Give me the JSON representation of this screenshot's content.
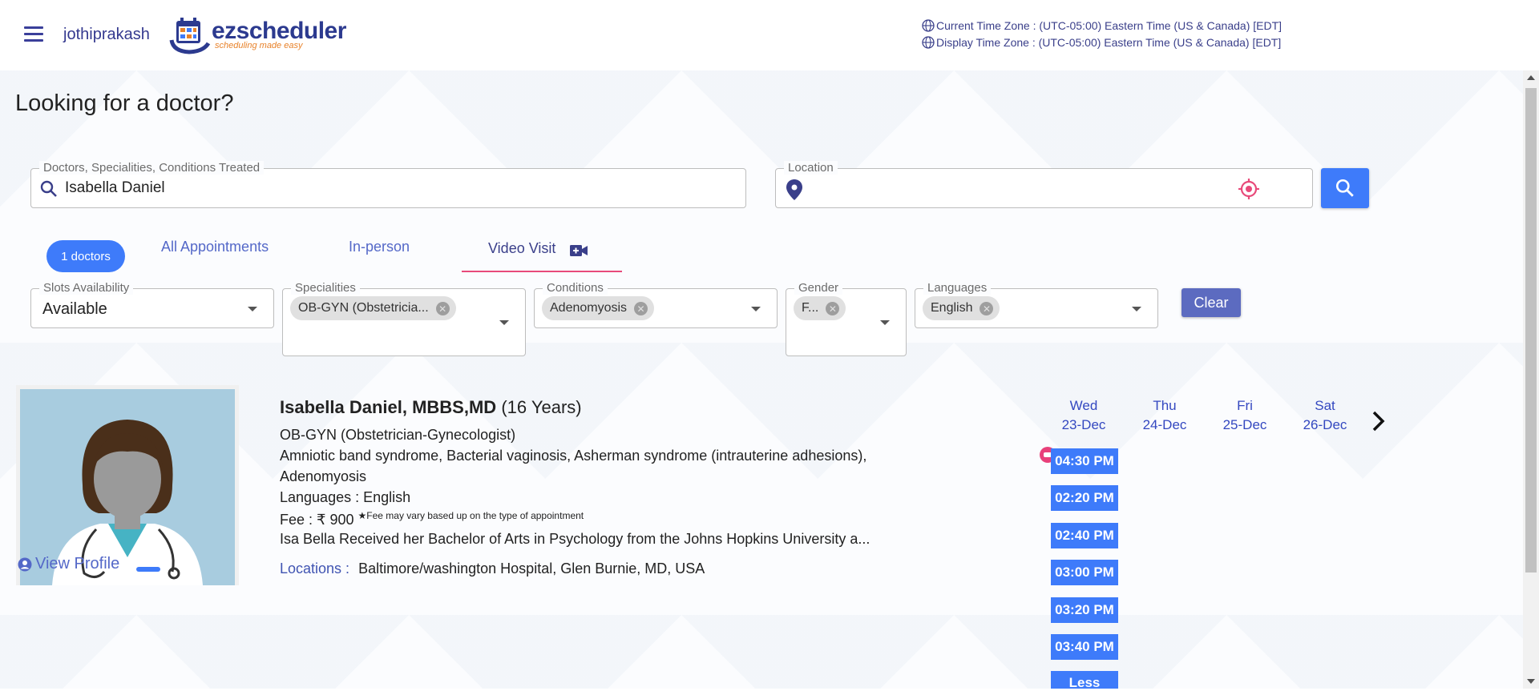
{
  "header": {
    "username": "jothiprakash",
    "logo": {
      "brand": "ezscheduler",
      "tagline": "scheduling made easy"
    },
    "current_tz": "Current Time Zone : (UTC-05:00) Eastern Time (US & Canada) [EDT]",
    "display_tz": "Display Time Zone : (UTC-05:00) Eastern Time (US & Canada) [EDT]"
  },
  "page_title": "Looking for a doctor?",
  "search": {
    "label": "Doctors, Specialities, Conditions Treated",
    "value": "Isabella Daniel"
  },
  "location": {
    "label": "Location",
    "value": ""
  },
  "tabs": {
    "count_pill": "1 doctors",
    "all": "All Appointments",
    "inperson": "In-person",
    "video": "Video Visit"
  },
  "filters": {
    "slots": {
      "label": "Slots Availability",
      "value": "Available"
    },
    "specialities": {
      "label": "Specialities",
      "chip": "OB-GYN (Obstetricia..."
    },
    "conditions": {
      "label": "Conditions",
      "chip": "Adenomyosis"
    },
    "gender": {
      "label": "Gender",
      "chip": "F..."
    },
    "languages": {
      "label": "Languages",
      "chip": "English"
    },
    "clear": "Clear"
  },
  "doctor": {
    "name": "Isabella Daniel, MBBS,MD",
    "experience": "(16 Years)",
    "speciality": "OB-GYN (Obstetrician-Gynecologist)",
    "conditions_line1": "Amniotic band syndrome, Bacterial vaginosis, Asherman syndrome (intrauterine adhesions),",
    "conditions_line2": "Adenomyosis",
    "languages": "Languages : English",
    "fee": "Fee : ₹ 900",
    "fee_note": "★Fee may vary based up on the type of appointment",
    "bio": "Isa Bella Received her Bachelor of Arts in Psychology from the Johns Hopkins University a...",
    "locations_label": "Locations :",
    "locations_value": "Baltimore/washington Hospital, Glen Burnie, MD, USA",
    "view_profile": "View Profile"
  },
  "schedule": {
    "days": [
      {
        "dow": "Wed",
        "date": "23-Dec"
      },
      {
        "dow": "Thu",
        "date": "24-Dec"
      },
      {
        "dow": "Fri",
        "date": "25-Dec"
      },
      {
        "dow": "Sat",
        "date": "26-Dec"
      }
    ],
    "slots": [
      "04:30 PM",
      "02:20 PM",
      "02:40 PM",
      "03:00 PM",
      "03:20 PM",
      "03:40 PM",
      "Less"
    ]
  },
  "colors": {
    "primary": "#3e7bfa",
    "indigo": "#5c6bc0",
    "accent_pink": "#e84a7a",
    "text_link": "#5468c8"
  },
  "icons": [
    "menu-icon",
    "globe-icon",
    "search-icon",
    "map-pin-icon",
    "gps-target-icon",
    "video-camera-icon",
    "chevron-right-icon",
    "account-circle-icon",
    "close-circle-icon",
    "dropdown-caret-icon"
  ]
}
